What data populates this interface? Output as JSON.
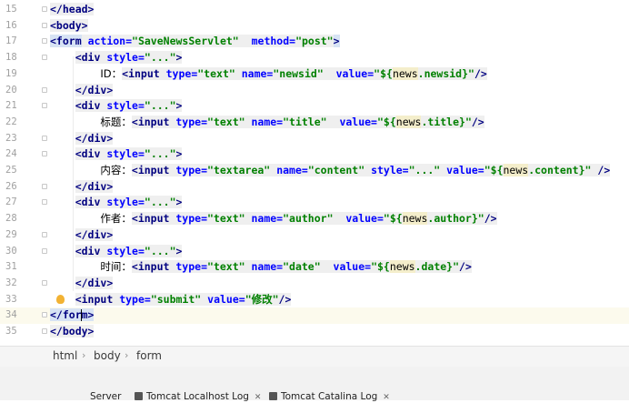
{
  "editor": {
    "lines": [
      {
        "n": "15",
        "fold": true,
        "tokens": [
          {
            "t": "</head>",
            "c": "tag"
          }
        ]
      },
      {
        "n": "16",
        "fold": true,
        "tokens": [
          {
            "t": "<body>",
            "c": "tag"
          }
        ]
      },
      {
        "n": "17",
        "fold": true,
        "tokens": [
          {
            "t": "<form",
            "c": "tagh"
          },
          {
            "t": " ",
            "c": "pl"
          },
          {
            "t": "action=",
            "c": "an"
          },
          {
            "t": "\"SaveNewsServlet\"",
            "c": "av"
          },
          {
            "t": "  ",
            "c": "pl"
          },
          {
            "t": "method=",
            "c": "an"
          },
          {
            "t": "\"post\"",
            "c": "av"
          },
          {
            "t": ">",
            "c": "tagh"
          }
        ]
      },
      {
        "n": "18",
        "fold": true,
        "indent": "    ",
        "tokens": [
          {
            "t": "<div",
            "c": "tag"
          },
          {
            "t": " ",
            "c": "pl"
          },
          {
            "t": "style=",
            "c": "an"
          },
          {
            "t": "\"...\"",
            "c": "av"
          },
          {
            "t": ">",
            "c": "tag"
          }
        ]
      },
      {
        "n": "19",
        "indent": "        ",
        "tokens": [
          {
            "t": "ID：",
            "c": "txt"
          },
          {
            "t": "<input",
            "c": "tag"
          },
          {
            "t": " ",
            "c": "pl"
          },
          {
            "t": "type=",
            "c": "an"
          },
          {
            "t": "\"text\"",
            "c": "av"
          },
          {
            "t": " ",
            "c": "pl"
          },
          {
            "t": "name=",
            "c": "an"
          },
          {
            "t": "\"newsid\"",
            "c": "av"
          },
          {
            "t": "  ",
            "c": "pl"
          },
          {
            "t": "value=",
            "c": "an"
          },
          {
            "t": "\"${",
            "c": "av"
          },
          {
            "t": "news",
            "c": "el"
          },
          {
            "t": ".newsid",
            "c": "av"
          },
          {
            "t": "}\"",
            "c": "av"
          },
          {
            "t": "/>",
            "c": "tag"
          }
        ]
      },
      {
        "n": "20",
        "fold": true,
        "indent": "    ",
        "tokens": [
          {
            "t": "</div>",
            "c": "tag"
          }
        ]
      },
      {
        "n": "21",
        "fold": true,
        "indent": "    ",
        "tokens": [
          {
            "t": "<div",
            "c": "tag"
          },
          {
            "t": " ",
            "c": "pl"
          },
          {
            "t": "style=",
            "c": "an"
          },
          {
            "t": "\"...\"",
            "c": "av"
          },
          {
            "t": ">",
            "c": "tag"
          }
        ]
      },
      {
        "n": "22",
        "indent": "        ",
        "tokens": [
          {
            "t": "标题：",
            "c": "txt"
          },
          {
            "t": "<input",
            "c": "tag"
          },
          {
            "t": " ",
            "c": "pl"
          },
          {
            "t": "type=",
            "c": "an"
          },
          {
            "t": "\"text\"",
            "c": "av"
          },
          {
            "t": " ",
            "c": "pl"
          },
          {
            "t": "name=",
            "c": "an"
          },
          {
            "t": "\"title\"",
            "c": "av"
          },
          {
            "t": "  ",
            "c": "pl"
          },
          {
            "t": "value=",
            "c": "an"
          },
          {
            "t": "\"${",
            "c": "av"
          },
          {
            "t": "news",
            "c": "el"
          },
          {
            "t": ".title",
            "c": "av"
          },
          {
            "t": "}\"",
            "c": "av"
          },
          {
            "t": "/>",
            "c": "tag"
          }
        ]
      },
      {
        "n": "23",
        "fold": true,
        "indent": "    ",
        "tokens": [
          {
            "t": "</div>",
            "c": "tag"
          }
        ]
      },
      {
        "n": "24",
        "fold": true,
        "indent": "    ",
        "tokens": [
          {
            "t": "<div",
            "c": "tag"
          },
          {
            "t": " ",
            "c": "pl"
          },
          {
            "t": "style=",
            "c": "an"
          },
          {
            "t": "\"...\"",
            "c": "av"
          },
          {
            "t": ">",
            "c": "tag"
          }
        ]
      },
      {
        "n": "25",
        "indent": "        ",
        "tokens": [
          {
            "t": "内容：",
            "c": "txt"
          },
          {
            "t": "<input",
            "c": "tag"
          },
          {
            "t": " ",
            "c": "pl"
          },
          {
            "t": "type=",
            "c": "an"
          },
          {
            "t": "\"textarea\"",
            "c": "av"
          },
          {
            "t": " ",
            "c": "pl"
          },
          {
            "t": "name=",
            "c": "an"
          },
          {
            "t": "\"content\"",
            "c": "av"
          },
          {
            "t": " ",
            "c": "pl"
          },
          {
            "t": "style=",
            "c": "an"
          },
          {
            "t": "\"...\"",
            "c": "av"
          },
          {
            "t": " ",
            "c": "pl"
          },
          {
            "t": "value=",
            "c": "an"
          },
          {
            "t": "\"${",
            "c": "av"
          },
          {
            "t": "news",
            "c": "el"
          },
          {
            "t": ".content",
            "c": "av"
          },
          {
            "t": "}\"",
            "c": "av"
          },
          {
            "t": " ",
            "c": "pl"
          },
          {
            "t": "/>",
            "c": "tag"
          }
        ]
      },
      {
        "n": "26",
        "fold": true,
        "indent": "    ",
        "tokens": [
          {
            "t": "</div>",
            "c": "tag"
          }
        ]
      },
      {
        "n": "27",
        "fold": true,
        "indent": "    ",
        "tokens": [
          {
            "t": "<div",
            "c": "tag"
          },
          {
            "t": " ",
            "c": "pl"
          },
          {
            "t": "style=",
            "c": "an"
          },
          {
            "t": "\"...\"",
            "c": "av"
          },
          {
            "t": ">",
            "c": "tag"
          }
        ]
      },
      {
        "n": "28",
        "indent": "        ",
        "tokens": [
          {
            "t": "作者：",
            "c": "txt"
          },
          {
            "t": "<input",
            "c": "tag"
          },
          {
            "t": " ",
            "c": "pl"
          },
          {
            "t": "type=",
            "c": "an"
          },
          {
            "t": "\"text\"",
            "c": "av"
          },
          {
            "t": " ",
            "c": "pl"
          },
          {
            "t": "name=",
            "c": "an"
          },
          {
            "t": "\"author\"",
            "c": "av"
          },
          {
            "t": "  ",
            "c": "pl"
          },
          {
            "t": "value=",
            "c": "an"
          },
          {
            "t": "\"${",
            "c": "av"
          },
          {
            "t": "news",
            "c": "el"
          },
          {
            "t": ".author",
            "c": "av"
          },
          {
            "t": "}\"",
            "c": "av"
          },
          {
            "t": "/>",
            "c": "tag"
          }
        ]
      },
      {
        "n": "29",
        "fold": true,
        "indent": "    ",
        "tokens": [
          {
            "t": "</div>",
            "c": "tag"
          }
        ]
      },
      {
        "n": "30",
        "fold": true,
        "indent": "    ",
        "tokens": [
          {
            "t": "<div",
            "c": "tag"
          },
          {
            "t": " ",
            "c": "pl"
          },
          {
            "t": "style=",
            "c": "an"
          },
          {
            "t": "\"...\"",
            "c": "av"
          },
          {
            "t": ">",
            "c": "tag"
          }
        ]
      },
      {
        "n": "31",
        "indent": "        ",
        "tokens": [
          {
            "t": "时间：",
            "c": "txt"
          },
          {
            "t": "<input",
            "c": "tag"
          },
          {
            "t": " ",
            "c": "pl"
          },
          {
            "t": "type=",
            "c": "an"
          },
          {
            "t": "\"text\"",
            "c": "av"
          },
          {
            "t": " ",
            "c": "pl"
          },
          {
            "t": "name=",
            "c": "an"
          },
          {
            "t": "\"date\"",
            "c": "av"
          },
          {
            "t": "  ",
            "c": "pl"
          },
          {
            "t": "value=",
            "c": "an"
          },
          {
            "t": "\"${",
            "c": "av"
          },
          {
            "t": "news",
            "c": "el"
          },
          {
            "t": ".date",
            "c": "av"
          },
          {
            "t": "}\"",
            "c": "av"
          },
          {
            "t": "/>",
            "c": "tag"
          }
        ]
      },
      {
        "n": "32",
        "fold": true,
        "indent": "    ",
        "tokens": [
          {
            "t": "</div>",
            "c": "tag"
          }
        ]
      },
      {
        "n": "33",
        "bulb": true,
        "indent": "    ",
        "tokens": [
          {
            "t": "<input",
            "c": "tag"
          },
          {
            "t": " ",
            "c": "pl"
          },
          {
            "t": "type=",
            "c": "an"
          },
          {
            "t": "\"submit\"",
            "c": "av"
          },
          {
            "t": " ",
            "c": "pl"
          },
          {
            "t": "value=",
            "c": "an"
          },
          {
            "t": "\"修改\"",
            "c": "av"
          },
          {
            "t": "/>",
            "c": "tag"
          }
        ]
      },
      {
        "n": "34",
        "fold": true,
        "current": true,
        "tokens": [
          {
            "t": "</for",
            "c": "tagh"
          },
          {
            "cursor": true
          },
          {
            "t": "m>",
            "c": "tagh"
          }
        ]
      },
      {
        "n": "35",
        "fold": true,
        "tokens": [
          {
            "t": "</body>",
            "c": "tag"
          }
        ]
      }
    ]
  },
  "breadcrumb": {
    "items": [
      {
        "label": "html"
      },
      {
        "label": "body"
      },
      {
        "label": "form"
      }
    ]
  },
  "bottom_tabs": [
    {
      "label": "Server"
    },
    {
      "label": "Tomcat Localhost Log"
    },
    {
      "label": "Tomcat Catalina Log"
    }
  ],
  "colors": {
    "tag": "#000080",
    "attr_name": "#0000ff",
    "attr_value": "#008000",
    "current_line": "#fcfaed"
  }
}
